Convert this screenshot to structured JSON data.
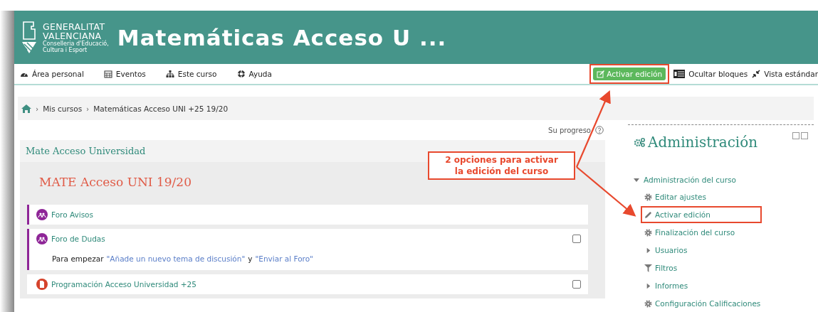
{
  "header": {
    "logo_lines": [
      "GENERALITAT",
      "VALENCIANA"
    ],
    "logo_sub": [
      "Conselleria d'Educació,",
      "Cultura i Esport"
    ],
    "title": "Matemáticas Acceso U ..."
  },
  "nav": {
    "items": [
      {
        "label": "Área personal"
      },
      {
        "label": "Eventos"
      },
      {
        "label": "Este curso"
      },
      {
        "label": "Ayuda"
      }
    ],
    "edit_button": {
      "label": "Activar edición",
      "highlighted": true
    },
    "right": [
      {
        "label": "Ocultar bloques"
      },
      {
        "label": "Vista estándar"
      }
    ]
  },
  "breadcrumb": [
    {
      "separator": "›",
      "label": "Mis cursos"
    },
    {
      "separator": "›",
      "label": "Matemáticas Acceso UNI +25 19/20"
    }
  ],
  "progress_label": "Su progreso",
  "course": {
    "section_title": "Mate Acceso Universidad",
    "heading": "MATE Acceso UNI 19/20",
    "activities": [
      {
        "kind": "forum",
        "name": "Foro Avisos"
      },
      {
        "kind": "forum",
        "name": "Foro de Dudas",
        "checked": false,
        "description": [
          {
            "kind": "text",
            "text": "Para empezar"
          },
          {
            "kind": "link",
            "text": "\"Añade un nuevo tema de discusión\""
          },
          {
            "kind": "text",
            "text": "y"
          },
          {
            "kind": "link",
            "text": "\"Enviar al Foro\""
          }
        ]
      },
      {
        "kind": "pdf",
        "name": "Programación Acceso Universidad +25",
        "checked": false
      }
    ]
  },
  "admin": {
    "title": "Administración",
    "group": {
      "label": "Administración del curso",
      "expanded": true,
      "items": [
        {
          "label": "Editar ajustes",
          "highlighted": false
        },
        {
          "label": "Activar edición",
          "highlighted": true
        },
        {
          "label": "Finalización del curso",
          "highlighted": false
        },
        {
          "label": "Usuarios",
          "highlighted": false
        },
        {
          "label": "Filtros",
          "highlighted": false
        },
        {
          "label": "Informes",
          "highlighted": false
        },
        {
          "label": "Configuración Calificaciones",
          "highlighted": false
        }
      ]
    }
  },
  "callout": [
    "2 opciones para activar",
    "la edición del curso"
  ]
}
